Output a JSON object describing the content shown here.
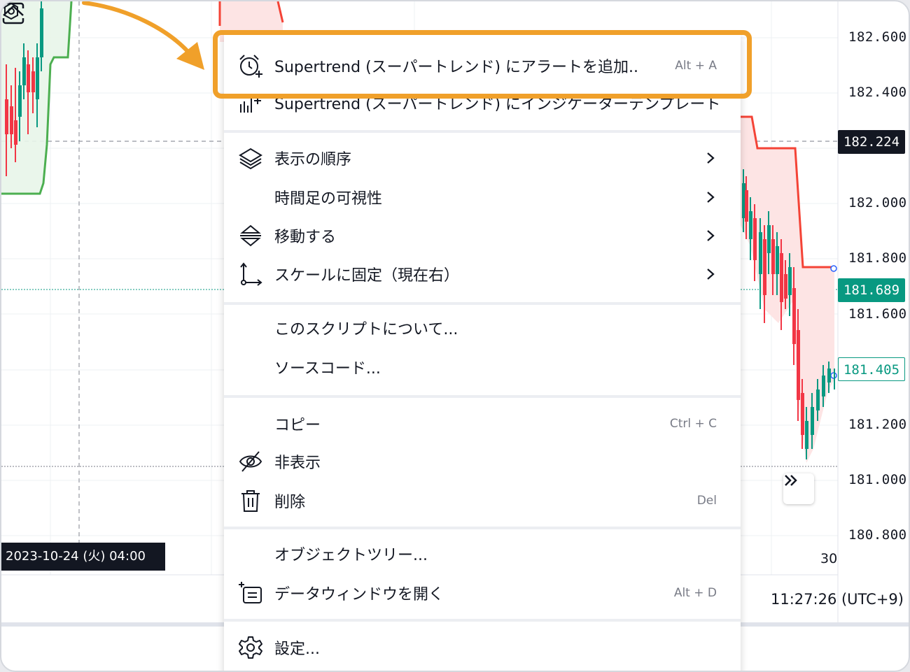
{
  "price_axis": {
    "labels": [
      "182.600",
      "182.400",
      "182.000",
      "181.800",
      "181.600",
      "181.200",
      "181.000",
      "180.800"
    ],
    "crosshair_price": "182.224",
    "last_price": "181.689",
    "indicator_price": "181.405"
  },
  "time_axis": {
    "crosshair_date": "2023-10-24 (火)   04:00",
    "tick_30": "30",
    "clock": "11:27:26 (UTC+9)"
  },
  "colors": {
    "up": "#089981",
    "down": "#f23645",
    "supertrend_up": "#4caf50",
    "supertrend_down": "#f44336",
    "highlight": "#f0a02a"
  },
  "menu": {
    "highlighted": {
      "label": "Supertrend (スーパートレンド) にアラートを追加..",
      "shortcut": "Alt + A",
      "icon": "alarm-clock-add-icon"
    },
    "partial": {
      "label": "Supertrend (スーパートレンド) にインジケーターテンプレート",
      "icon": "indicator-bars-icon"
    },
    "items": [
      {
        "label": "表示の順序",
        "icon": "layers-icon",
        "submenu": true
      },
      {
        "label": "時間足の可視性",
        "icon": "",
        "submenu": true
      },
      {
        "label": "移動する",
        "icon": "move-layers-icon",
        "submenu": true
      },
      {
        "label": "スケールに固定（現在右）",
        "icon": "scale-axis-icon",
        "submenu": true
      },
      {
        "label": "このスクリプトについて...",
        "icon": ""
      },
      {
        "label": "ソースコード...",
        "icon": ""
      },
      {
        "label": "コピー",
        "icon": "",
        "shortcut": "Ctrl + C"
      },
      {
        "label": "非表示",
        "icon": "eye-hidden-icon"
      },
      {
        "label": "削除",
        "icon": "trash-icon",
        "shortcut": "Del"
      },
      {
        "label": "オブジェクトツリー...",
        "icon": ""
      },
      {
        "label": "データウィンドウを開く",
        "icon": "data-window-icon",
        "shortcut": "Alt + D"
      },
      {
        "label": "設定...",
        "icon": "gear-icon"
      }
    ]
  }
}
